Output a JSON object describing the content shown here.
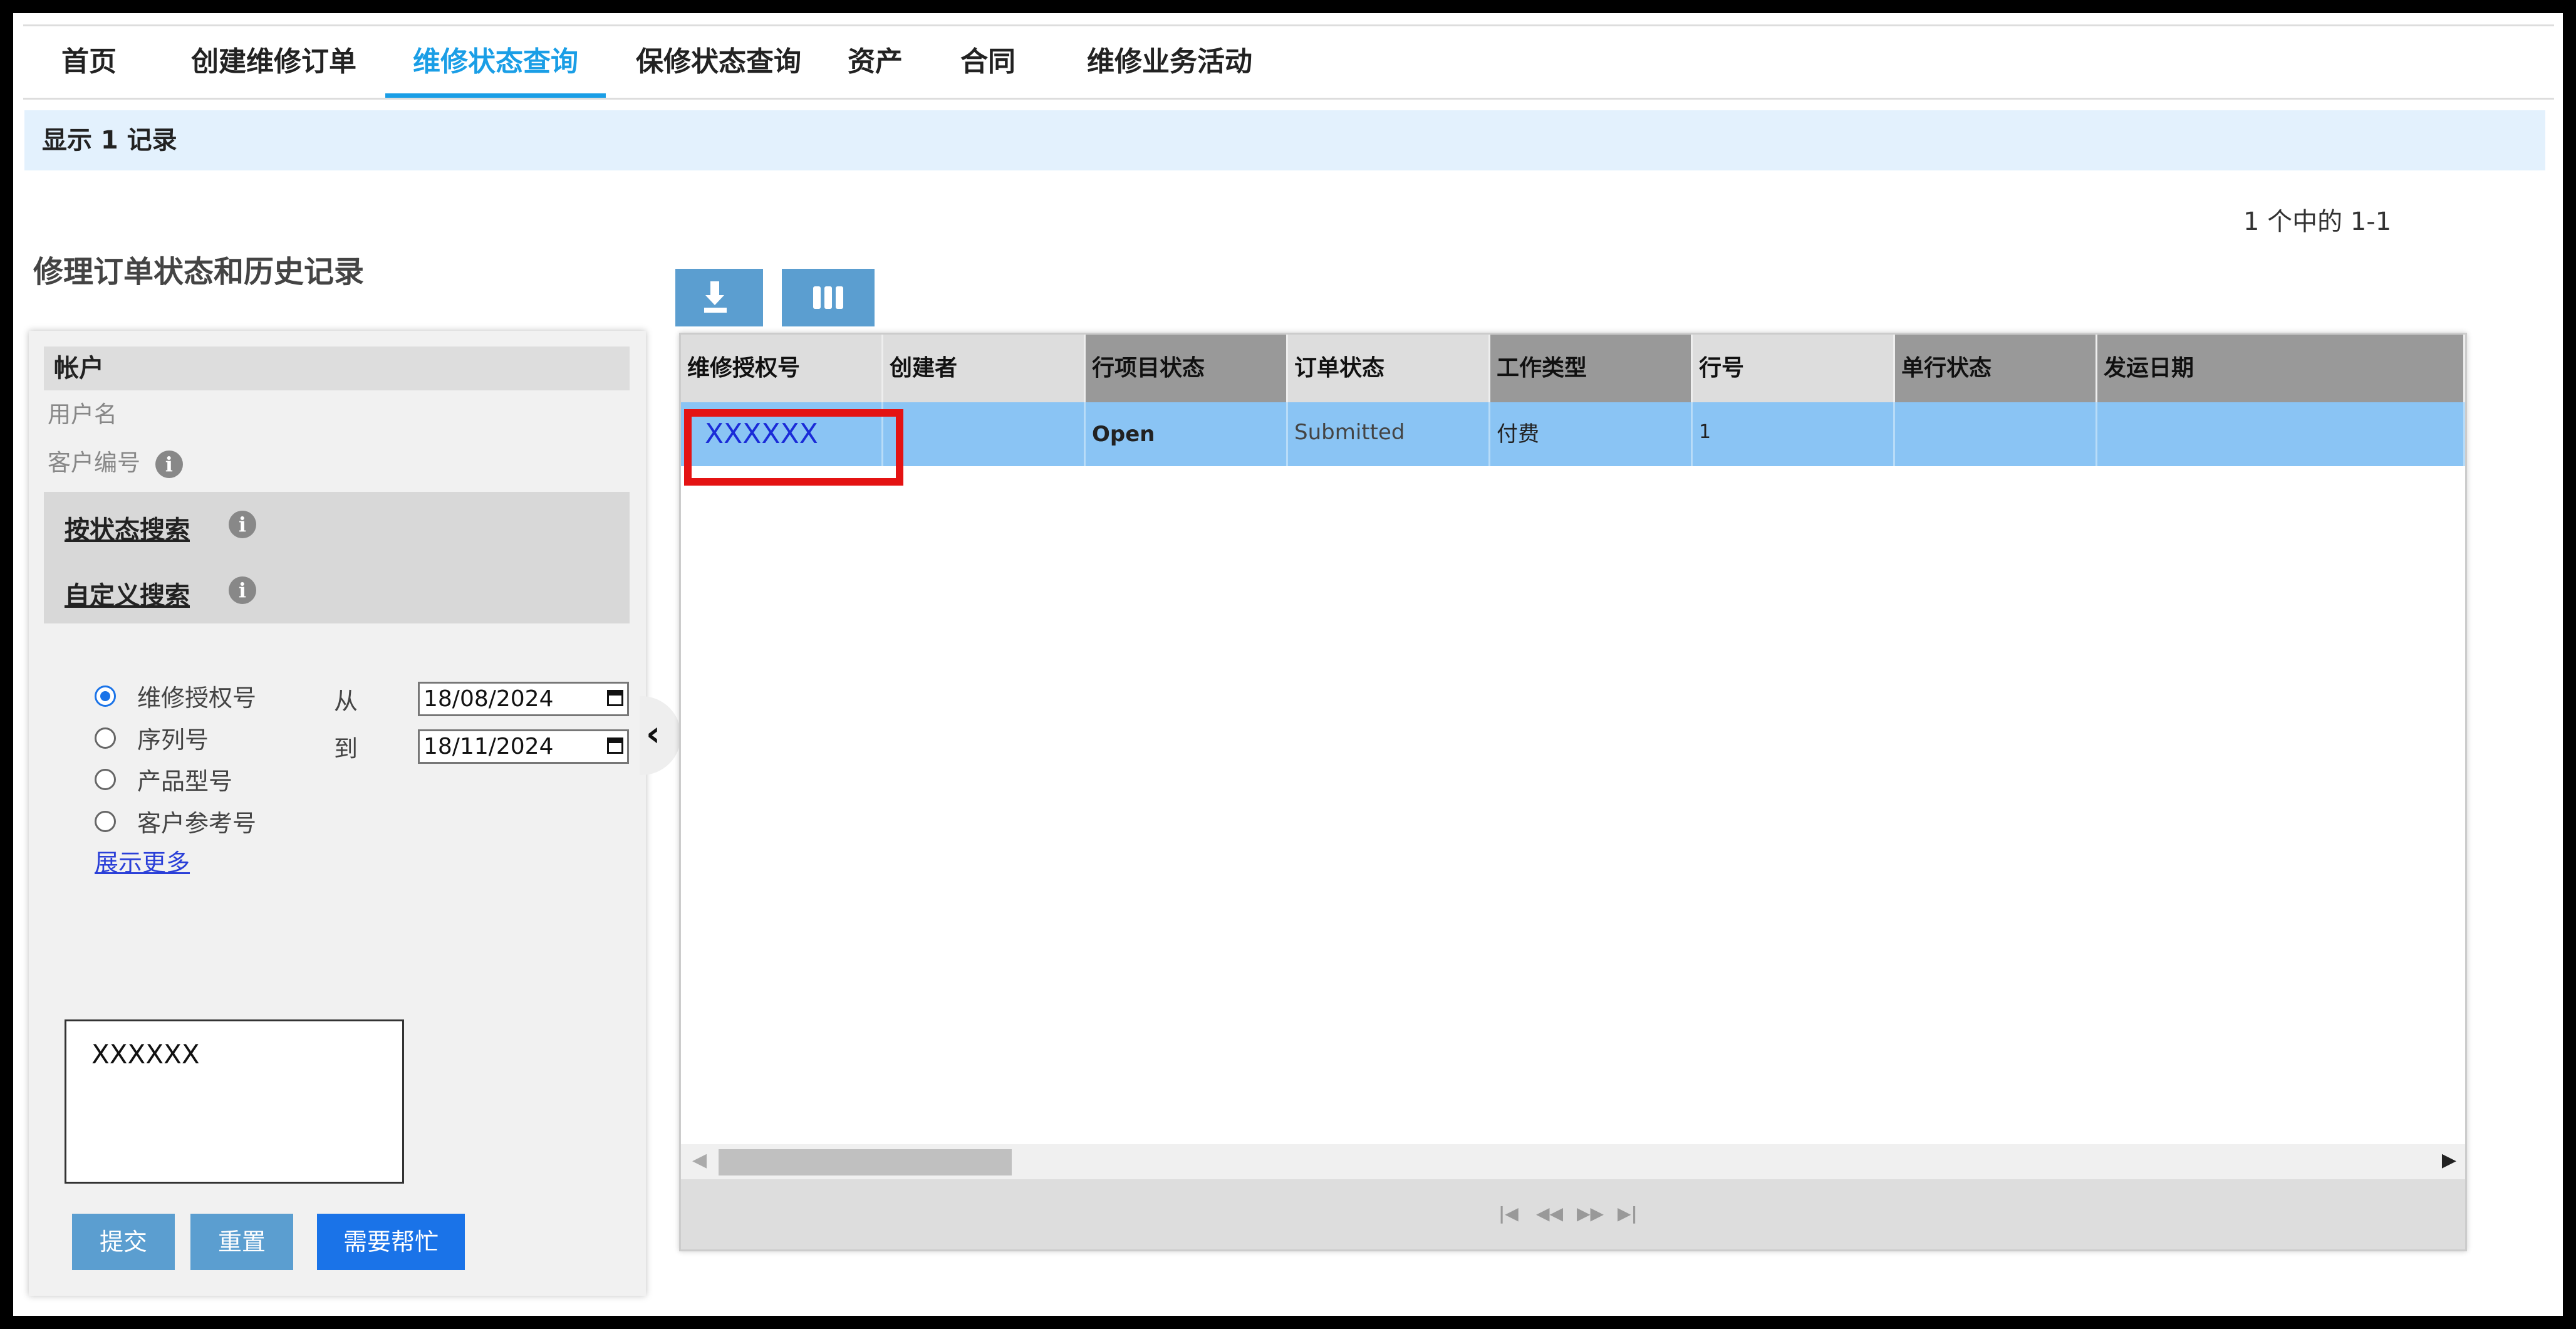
{
  "nav": {
    "items": [
      "首页",
      "创建维修订单",
      "维修状态查询",
      "保修状态查询",
      "资产",
      "合同",
      "维修业务活动"
    ],
    "active_index": 2
  },
  "records_label": "显示 1 记录",
  "pagination_text": "1 个中的 1-1",
  "page_title": "修理订单状态和历史记录",
  "account": {
    "heading": "帐户",
    "username_label": "用户名",
    "customer_no_label": "客户编号"
  },
  "search": {
    "by_status": "按状态搜索",
    "custom": "自定义搜索",
    "radio_options": [
      "维修授权号",
      "序列号",
      "产品型号",
      "客户参考号"
    ],
    "selected_radio": 0,
    "from_label": "从",
    "to_label": "到",
    "from_date": "18/08/2024",
    "to_date": "18/11/2024",
    "show_more": "展示更多",
    "textarea_value": "XXXXXX",
    "buttons": {
      "submit": "提交",
      "reset": "重置",
      "help": "需要帮忙"
    }
  },
  "icons": {
    "info": "info-icon",
    "download": "download-icon",
    "columns": "columns-icon",
    "collapse": "chevron-left-icon"
  },
  "colors": {
    "accent": "#1a9ee6",
    "selected_row": "#8ac4f4",
    "button": "#5b9ed0",
    "help_button": "#1a73e8",
    "highlight": "#e41313"
  },
  "table": {
    "headers": [
      "维修授权号",
      "创建者",
      "行项目状态",
      "订单状态",
      "工作类型",
      "行号",
      "单行状态",
      "发运日期"
    ],
    "rows": [
      [
        "XXXXXX",
        "",
        "Open",
        "Submitted",
        "付费",
        "1",
        "",
        ""
      ]
    ]
  }
}
